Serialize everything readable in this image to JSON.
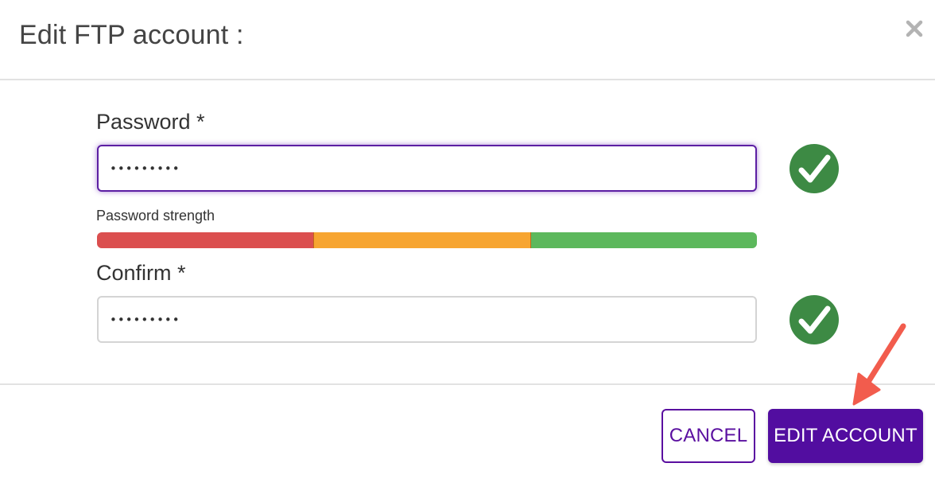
{
  "modal": {
    "title": "Edit FTP account :",
    "close_icon": "close-icon"
  },
  "form": {
    "password": {
      "label": "Password *",
      "value": "•••••••••",
      "valid_icon": "check-circle-icon"
    },
    "strength": {
      "label": "Password strength",
      "level": "strong",
      "segments": [
        "weak",
        "medium",
        "strong"
      ],
      "colors": {
        "weak": "#db4f4f",
        "medium": "#f7a531",
        "strong": "#5cb85c"
      }
    },
    "confirm": {
      "label": "Confirm *",
      "value": "•••••••••",
      "valid_icon": "check-circle-icon"
    }
  },
  "footer": {
    "cancel_label": "CANCEL",
    "submit_label": "EDIT ACCOUNT"
  },
  "annotation": {
    "arrow_icon": "annotation-arrow-icon",
    "color": "#f25c4d"
  },
  "colors": {
    "accent": "#520da0",
    "success": "#3d8a44",
    "divider": "#e2e2e2"
  }
}
